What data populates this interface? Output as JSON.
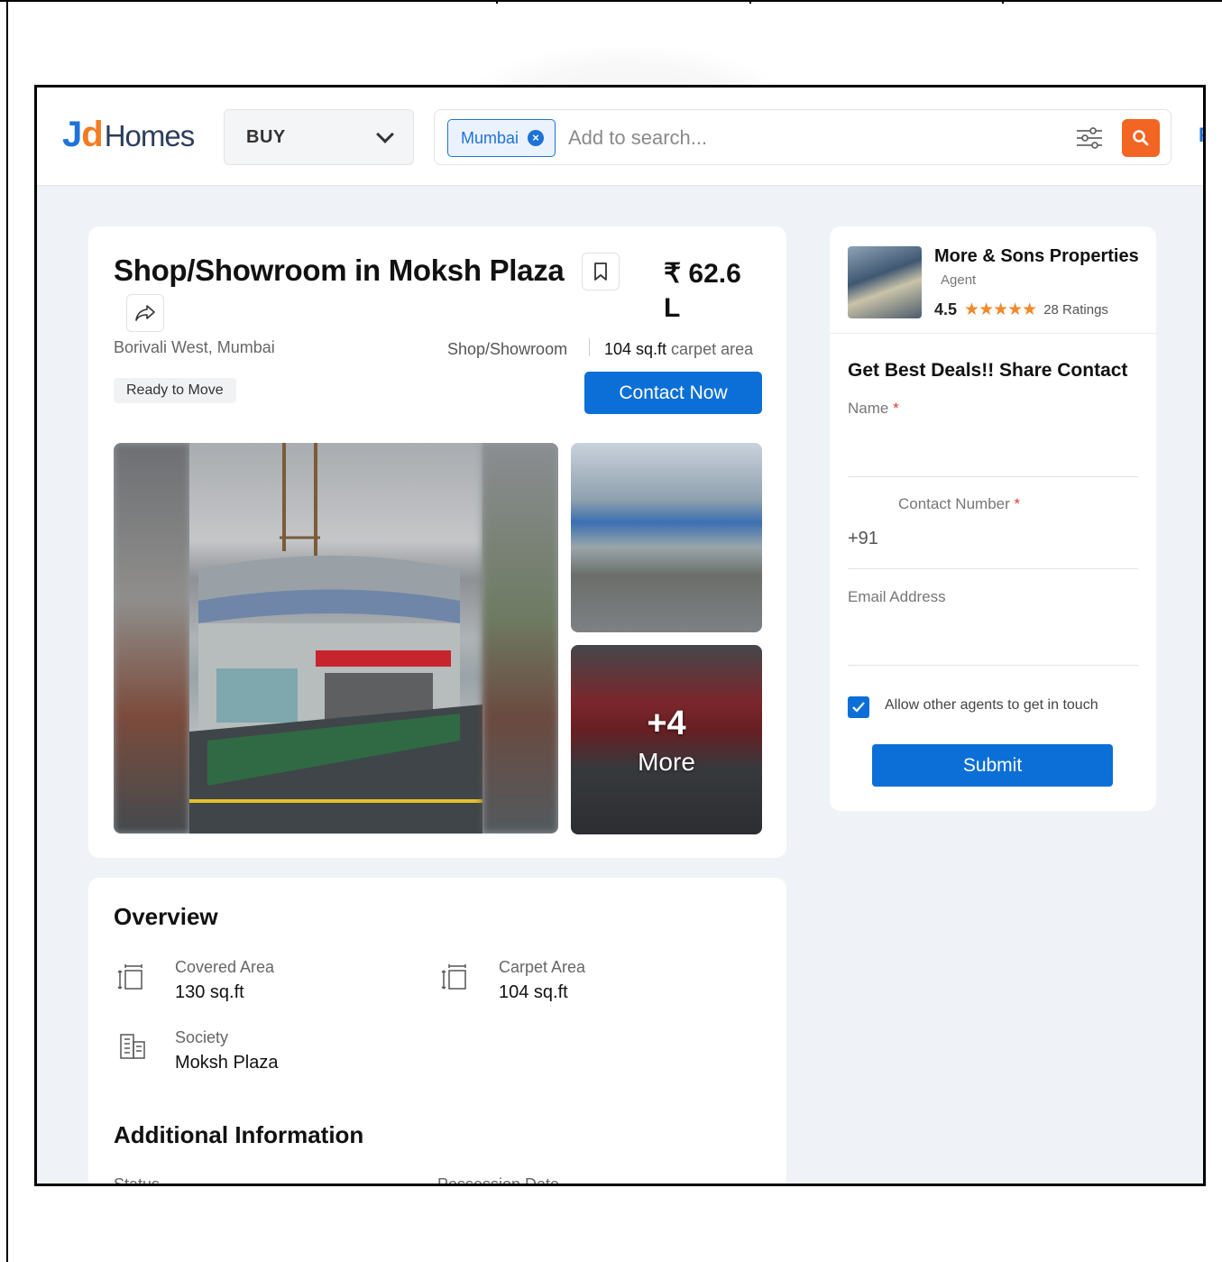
{
  "header": {
    "logo_jd": "J",
    "logo_d": "d",
    "logo_homes": "Homes",
    "buy_label": "BUY",
    "city_chip": "Mumbai",
    "search_placeholder": "Add to search...",
    "edge_letter": "F"
  },
  "listing": {
    "title": "Shop/Showroom in Moksh Plaza",
    "price_line1": "₹ 62.6",
    "price_line2": "L",
    "location": "Borivali West, Mumbai",
    "property_type": "Shop/Showroom",
    "area_value": "104 sq.ft",
    "area_suffix": " carpet area",
    "status_tag": "Ready to Move",
    "contact_button": "Contact Now",
    "more_photos_count": "+4",
    "more_photos_label": "More"
  },
  "agent": {
    "name": "More & Sons Properties",
    "role": "Agent",
    "rating": "4.5",
    "stars": "★★★★★",
    "rating_count": "28 Ratings"
  },
  "form": {
    "title": "Get Best Deals!! Share Contact",
    "name_label": "Name",
    "contact_label": "Contact Number",
    "phone_prefix": "+91",
    "email_label": "Email Address",
    "required_mark": "*",
    "allow_agents_label": "Allow other agents to get in touch",
    "allow_agents_checked": true,
    "submit_button": "Submit"
  },
  "overview": {
    "heading": "Overview",
    "items": [
      {
        "label": "Covered Area",
        "value": "130 sq.ft",
        "icon": "area-resize-icon"
      },
      {
        "label": "Carpet Area",
        "value": "104 sq.ft",
        "icon": "area-resize-icon"
      },
      {
        "label": "Society",
        "value": "Moksh Plaza",
        "icon": "building-icon"
      }
    ]
  },
  "additional": {
    "heading": "Additional Information",
    "status_label": "Status",
    "possession_label": "Possession Date"
  },
  "colors": {
    "brand_blue": "#0b6fd7",
    "brand_orange": "#f26522",
    "page_bg": "#eff3f7"
  }
}
